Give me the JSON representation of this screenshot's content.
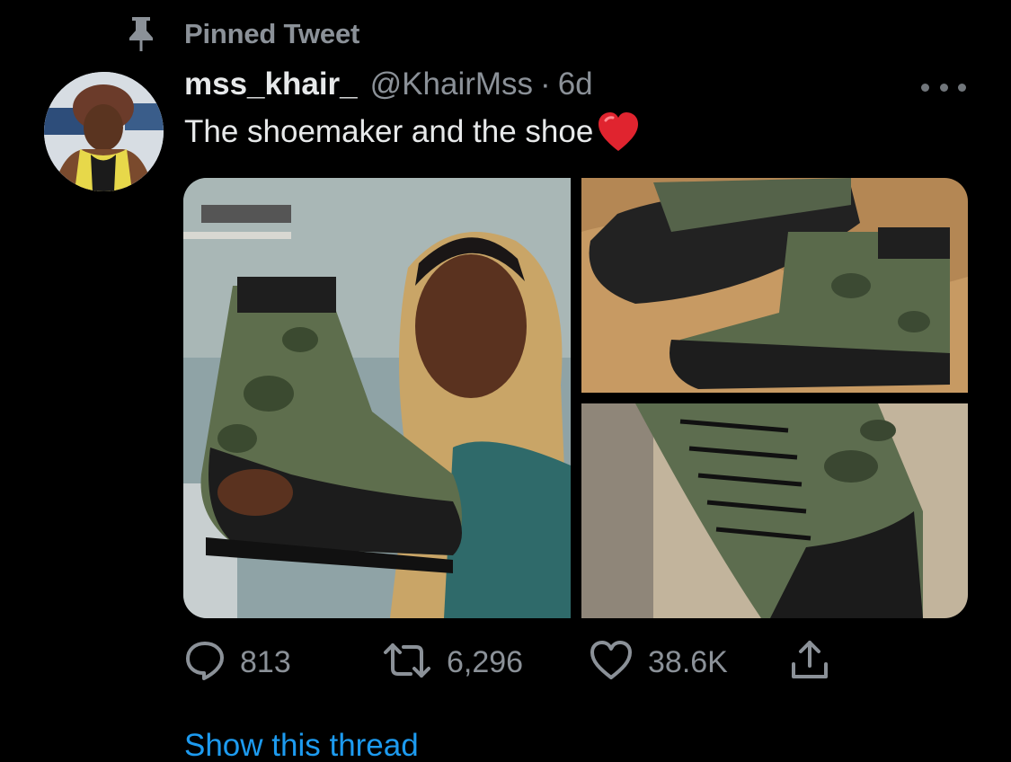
{
  "pinned": {
    "label": "Pinned Tweet",
    "icon": "pin-icon"
  },
  "author": {
    "display_name": "mss_khair_",
    "handle": "@KhairMss",
    "separator": "·",
    "time": "6d"
  },
  "tweet": {
    "text": "The shoemaker and the shoe",
    "emoji": "red-heart-icon"
  },
  "media": {
    "count": 3,
    "photos": [
      {
        "description_icon": "photo-woman-holding-boot"
      },
      {
        "description_icon": "photo-boots-on-velvet"
      },
      {
        "description_icon": "photo-boot-laces-closeup"
      }
    ]
  },
  "actions": {
    "reply_count": "813",
    "retweet_count": "6,296",
    "like_count": "38.6K"
  },
  "thread": {
    "label": "Show this thread"
  },
  "colors": {
    "background": "#000000",
    "primary_text": "#e7e9ea",
    "secondary_text": "#8b9198",
    "link": "#1d9bf0",
    "heart": "#e0242f"
  }
}
